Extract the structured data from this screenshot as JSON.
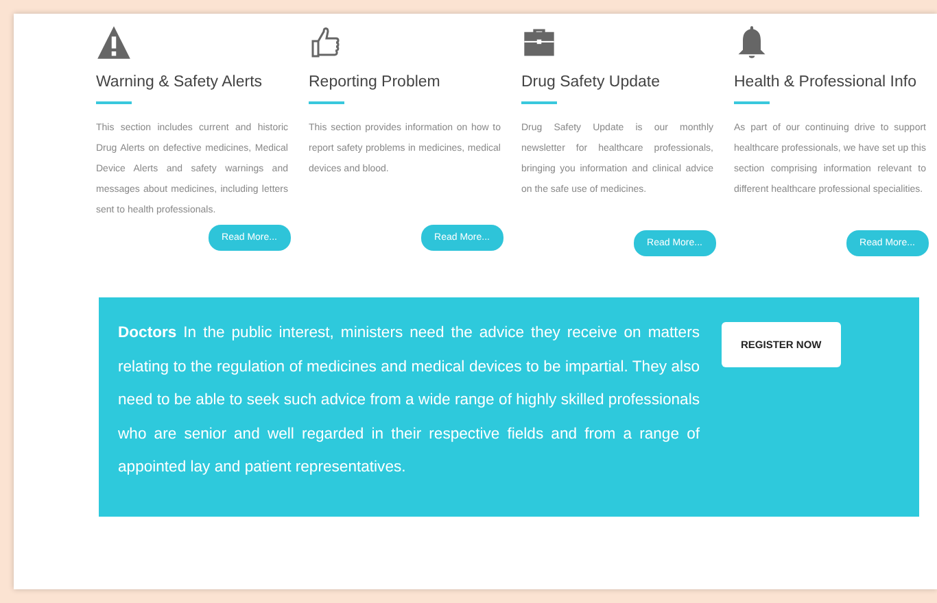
{
  "cards": [
    {
      "kind": "warning",
      "title": "Warning & Safety Alerts",
      "text": "This section includes current and historic Drug Alerts on defective medicines, Medical Device Alerts and safety warnings and messages about medicines, including letters sent to health professionals.",
      "button": "Read More..."
    },
    {
      "kind": "thumbs-up",
      "title": "Reporting Problem",
      "text": "This section provides information on how to report safety problems in medicines, medical devices and blood.",
      "button": "Read More..."
    },
    {
      "kind": "briefcase",
      "title": "Drug Safety Update",
      "text": "Drug Safety Update is our monthly newsletter for healthcare professionals, bringing you information and clinical advice on the safe use of medicines.",
      "button": "Read More..."
    },
    {
      "kind": "bell",
      "title": "Health & Professional Info",
      "text": "As part of our continuing drive to support healthcare professionals, we have set up this section comprising information relevant to different healthcare professional specialities.",
      "button": "Read More..."
    }
  ],
  "banner": {
    "text": "**Doctors** In the public interest, ministers need the advice they receive on matters relating to the regulation of medicines and medical devices to be impartial. They also need to be able to seek such advice from a wide range of highly skilled professionals who are senior and well regarded in their respective fields and from a range of appointed lay and patient representatives.",
    "button": "REGISTER NOW"
  }
}
